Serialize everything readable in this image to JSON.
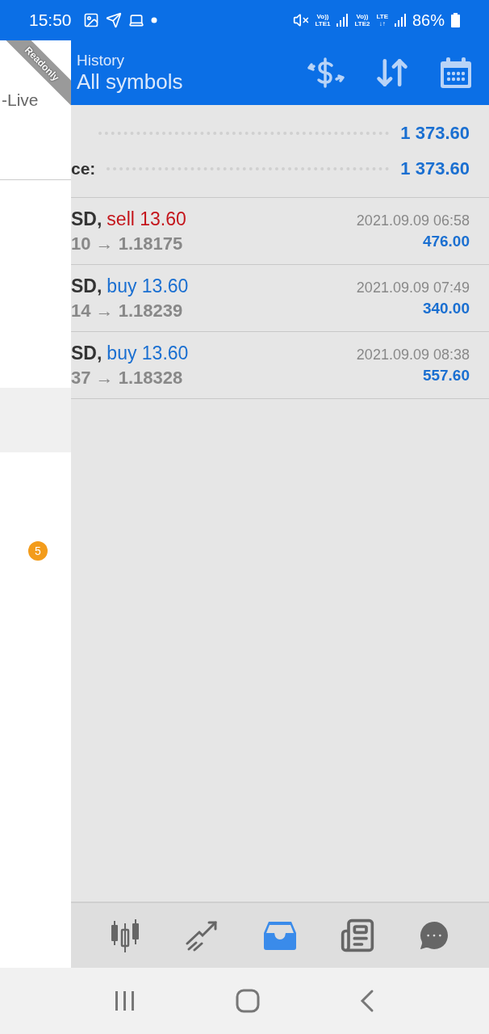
{
  "status_bar": {
    "time": "15:50",
    "networks": [
      {
        "top": "Vo))",
        "bottom": "LTE1"
      },
      {
        "top": "Vo))",
        "bottom": "LTE2"
      },
      {
        "top": "LTE",
        "bottom": "↓↑"
      }
    ],
    "battery": "86%"
  },
  "drawer": {
    "ribbon": "Readonly",
    "account": "-Live",
    "badge": "5"
  },
  "header": {
    "title": "History",
    "subtitle": "All symbols"
  },
  "summary": [
    {
      "value": "1 373.60"
    },
    {
      "label": "ce:",
      "value": "1 373.60"
    }
  ],
  "trades": [
    {
      "symbol": "SD,",
      "kind": "sell",
      "order": "sell 13.60",
      "prices": "10 → 1.18175",
      "time": "2021.09.09 06:58",
      "profit": "476.00"
    },
    {
      "symbol": "SD,",
      "kind": "buy",
      "order": "buy 13.60",
      "prices": "14 → 1.18239",
      "time": "2021.09.09 07:49",
      "profit": "340.00"
    },
    {
      "symbol": "SD,",
      "kind": "buy",
      "order": "buy 13.60",
      "prices": "37 → 1.18328",
      "time": "2021.09.09 08:38",
      "profit": "557.60"
    }
  ],
  "bottom_nav": [
    {
      "kind": "quotes",
      "selected": false
    },
    {
      "kind": "trade",
      "selected": false
    },
    {
      "kind": "history",
      "selected": true
    },
    {
      "kind": "news",
      "selected": false
    },
    {
      "kind": "chat",
      "selected": false
    }
  ]
}
